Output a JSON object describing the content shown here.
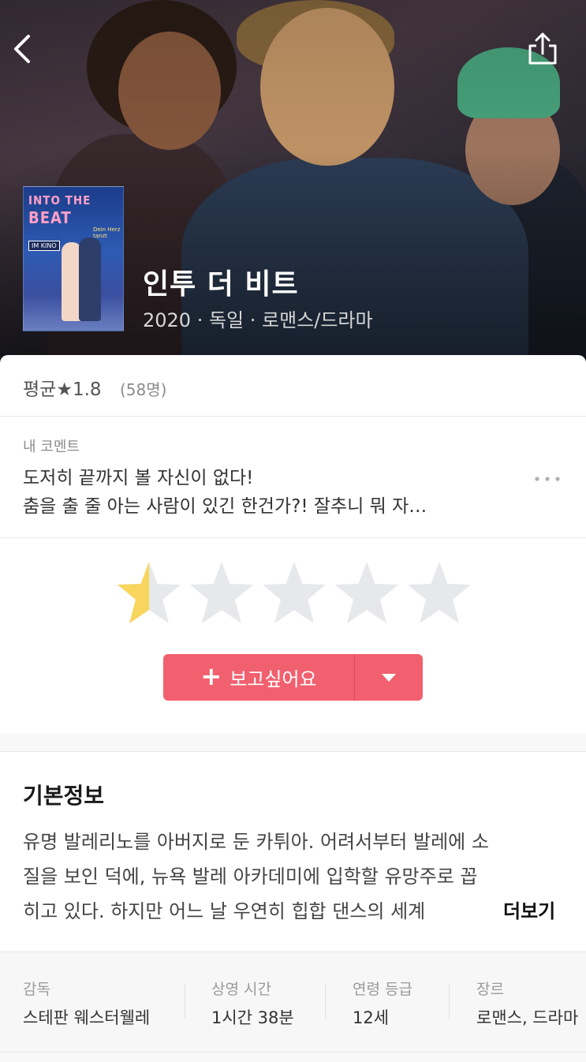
{
  "movie": {
    "title": "인투 더 비트",
    "meta": "2020 · 독일 · 로맨스/드라마",
    "poster": {
      "title_line1": "INTO THE",
      "title_line2": "BEAT",
      "tag": "IM KINO",
      "subtitle": "Dein Herz tanzt"
    }
  },
  "rating": {
    "average_label": "평균★1.8",
    "count": "(58명)",
    "user_rating": 0.5,
    "max_stars": 5
  },
  "comment": {
    "label": "내 코멘트",
    "line1": "도저히 끝까지 볼 자신이 없다!",
    "line2": "춤을 출 줄 아는 사람이 있긴 한건가?! 잘추니 뭐 자…"
  },
  "wishlist": {
    "label": "보고싶어요",
    "plus": "+"
  },
  "info": {
    "title": "기본정보",
    "synopsis_lines": [
      "유명 발레리노를 아버지로 둔 카튀아. 어려서부터 발레에 소",
      "질을 보인 덕에, 뉴욕 발레 아카데미에 입학할 유망주로 꼽",
      "히고 있다. 하지만 어느 날 우연히 힙합 댄스의 세계"
    ],
    "more_label": "더보기"
  },
  "facts": [
    {
      "key": "감독",
      "value": "스테판 웨스터웰레"
    },
    {
      "key": "상영 시간",
      "value": "1시간 38분"
    },
    {
      "key": "연령 등급",
      "value": "12세"
    },
    {
      "key": "장르",
      "value": "로맨스, 드라마"
    }
  ],
  "colors": {
    "accent": "#f1606f",
    "star_filled": "#f8d55d",
    "star_empty": "#e6e8eb"
  },
  "icons": {
    "back": "chevron-left-icon",
    "share": "share-icon",
    "more": "more-horizontal-icon",
    "dropdown": "caret-down-icon"
  }
}
